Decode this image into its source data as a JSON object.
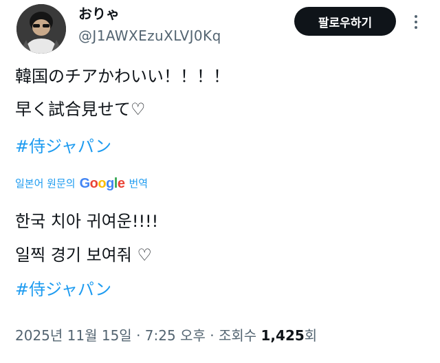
{
  "author": {
    "display_name": "おりゃ",
    "handle": "@J1AWXEzuXLVJ0Kq"
  },
  "actions": {
    "follow_label": "팔로우하기",
    "more_icon": "more-dots-icon"
  },
  "tweet": {
    "lines": [
      "韓国のチアかわいい！！！！",
      "早く試合見せて♡"
    ],
    "hashtag": "#侍ジャパン"
  },
  "translation": {
    "prefix": "일본어 원문의",
    "logo": [
      "G",
      "o",
      "o",
      "g",
      "l",
      "e"
    ],
    "suffix": "번역",
    "lines": [
      "한국 치아 귀여운!!!!",
      "일찍 경기 보여줘 ♡"
    ],
    "hashtag": "#侍ジャパン"
  },
  "meta": {
    "date": "2025년 11월 15일",
    "time": "7:25 오후",
    "views_label": "조회수",
    "views_count": "1,425",
    "views_suffix": "회",
    "separator": "·"
  },
  "colors": {
    "accent": "#1d9bf0",
    "secondary_text": "#536471",
    "button_bg": "#0f1419"
  }
}
